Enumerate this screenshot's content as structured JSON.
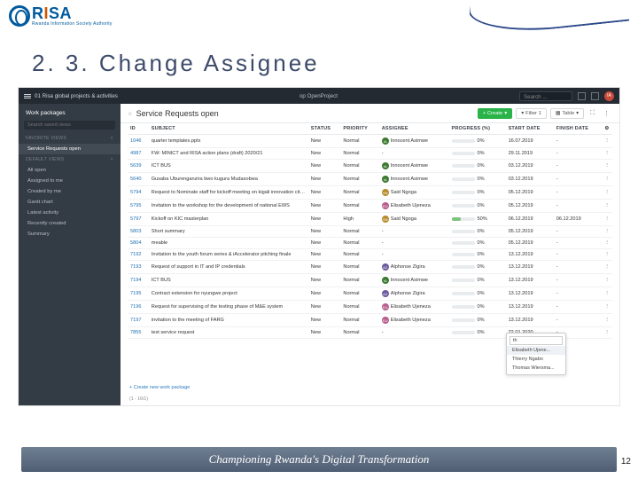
{
  "logo": {
    "brand": "RISA",
    "tagline": "Rwanda Information Society Authority"
  },
  "section_title": "2. 3. Change Assignee",
  "footer_text": "Championing Rwanda's Digital Transformation",
  "page_number": "12",
  "topbar": {
    "title": "01 Risa global projects & activities",
    "center": "op OpenProject",
    "search_placeholder": "Search ...",
    "avatar_initials": "IA"
  },
  "sidebar": {
    "module_label": "Work packages",
    "search_placeholder": "Search saved views",
    "fav_header": "FAVORITE VIEWS",
    "fav_item": "Service Requests open",
    "def_header": "DEFAULT VIEWS",
    "items": [
      "All open",
      "Assigned to me",
      "Created by me",
      "Gantt chart",
      "Latest activity",
      "Recently created",
      "Summary"
    ]
  },
  "main": {
    "title": "Service Requests open",
    "create_label": "+ Create",
    "filter_label": "Filter 1",
    "table_label": "Table",
    "add_link": "+  Create new work package",
    "footer_count": "(1 - 16/1)"
  },
  "columns": [
    "ID",
    "SUBJECT",
    "STATUS",
    "PRIORITY",
    "ASSIGNEE",
    "PROGRESS (%)",
    "START DATE",
    "FINISH DATE"
  ],
  "rows": [
    {
      "id": "1046",
      "subj": "quarter templates.pptx",
      "st": "New",
      "pr": "Normal",
      "as": "Innocent Asimwe",
      "av": "ia",
      "pct": "0%",
      "sd": "16.07.2019",
      "fd": "-"
    },
    {
      "id": "4987",
      "subj": "FW: MINICT and RISA action plans (draft) 2020/21",
      "st": "New",
      "pr": "Normal",
      "as": "",
      "av": "",
      "pct": "0%",
      "sd": "29.11.2019",
      "fd": "-"
    },
    {
      "id": "5639",
      "subj": "ICT BUS",
      "st": "New",
      "pr": "Normal",
      "as": "Innocent Asimwe",
      "av": "ia",
      "pct": "0%",
      "sd": "03.12.2019",
      "fd": "-"
    },
    {
      "id": "5640",
      "subj": "Gusaba Uburenganzira bwo kugura Mudasobwa",
      "st": "New",
      "pr": "Normal",
      "as": "Innocent Asimwe",
      "av": "ia",
      "pct": "0%",
      "sd": "03.12.2019",
      "fd": "-"
    },
    {
      "id": "5794",
      "subj": "Request to Nominate staff for kickoff meeting on kigali innovation city maste...",
      "st": "New",
      "pr": "Normal",
      "as": "Said Ngoga",
      "av": "sn",
      "pct": "0%",
      "sd": "05.12.2019",
      "fd": "-"
    },
    {
      "id": "5795",
      "subj": "Invitation to the workshop for the development of national EWS",
      "st": "New",
      "pr": "Normal",
      "as": "Elisabeth Ujeneza",
      "av": "eu",
      "pct": "0%",
      "sd": "05.12.2019",
      "fd": "-"
    },
    {
      "id": "5797",
      "subj": "Kickoff on KIC masterplan",
      "st": "New",
      "pr": "High",
      "as": "Said Ngoga",
      "av": "sn",
      "pct": "50%",
      "sd": "06.12.2019",
      "fd": "06.12.2019"
    },
    {
      "id": "5803",
      "subj": "Short summary",
      "st": "New",
      "pr": "Normal",
      "as": "",
      "av": "",
      "pct": "0%",
      "sd": "05.12.2019",
      "fd": "-"
    },
    {
      "id": "5804",
      "subj": "meable",
      "st": "New",
      "pr": "Normal",
      "as": "",
      "av": "",
      "pct": "0%",
      "sd": "05.12.2019",
      "fd": "-"
    },
    {
      "id": "7192",
      "subj": "Invitation to the youth forum series & iAccelerator pitching finale",
      "st": "New",
      "pr": "Normal",
      "as": "",
      "av": "",
      "pct": "0%",
      "sd": "13.12.2019",
      "fd": "-"
    },
    {
      "id": "7193",
      "subj": "Request of support in IT and IP credentials",
      "st": "New",
      "pr": "Normal",
      "as": "Alphonse Zigira",
      "av": "az",
      "pct": "0%",
      "sd": "13.12.2019",
      "fd": "-"
    },
    {
      "id": "7194",
      "subj": "ICT BUS",
      "st": "New",
      "pr": "Normal",
      "as": "Innocent Asimwe",
      "av": "ia",
      "pct": "0%",
      "sd": "13.12.2019",
      "fd": "-"
    },
    {
      "id": "7195",
      "subj": "Contract extension for nyungwe project",
      "st": "New",
      "pr": "Normal",
      "as": "Alphonse Zigira",
      "av": "az",
      "pct": "0%",
      "sd": "13.12.2019",
      "fd": "-"
    },
    {
      "id": "7196",
      "subj": "Request for supervising of the testing phase of M&E system",
      "st": "New",
      "pr": "Normal",
      "as": "Elisabeth Ujeneza",
      "av": "eu",
      "pct": "0%",
      "sd": "13.12.2019",
      "fd": "-"
    },
    {
      "id": "7197",
      "subj": "invitation to the meeting of FARG",
      "st": "New",
      "pr": "Normal",
      "as": "Elisabeth Ujeneza",
      "av": "eu",
      "pct": "0%",
      "sd": "13.12.2019",
      "fd": "-"
    },
    {
      "id": "7855",
      "subj": "test service request",
      "st": "New",
      "pr": "Normal",
      "as": "",
      "av": "",
      "pct": "0%",
      "sd": "22.01.2020",
      "fd": "-"
    }
  ],
  "dropdown": {
    "field_value": "th",
    "items": [
      "Elisabeth Ujene...",
      "Thierry Ngabo",
      "Thomas Wiersma..."
    ]
  }
}
